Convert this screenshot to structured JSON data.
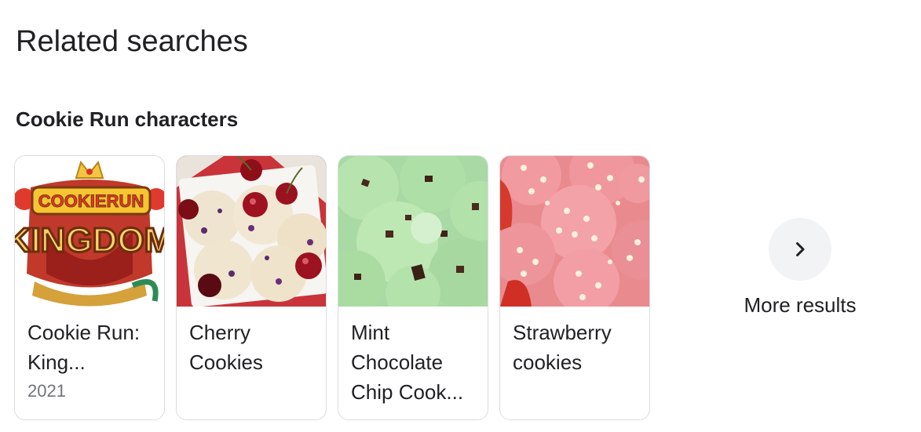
{
  "section_title": "Related searches",
  "group_title": "Cookie Run characters",
  "cards": [
    {
      "title": "Cookie Run:\nKing...",
      "subtitle": "2021",
      "image": "cookie-run-kingdom-logo"
    },
    {
      "title": "Cherry\nCookies",
      "subtitle": "",
      "image": "cherry-cookies-photo"
    },
    {
      "title": "Mint\nChocolate\nChip Cook...",
      "subtitle": "",
      "image": "mint-chocolate-chip-cookies-photo"
    },
    {
      "title": "Strawberry\ncookies",
      "subtitle": "",
      "image": "strawberry-cookies-photo"
    }
  ],
  "more": {
    "label": "More results",
    "icon": "chevron-right-icon"
  },
  "logo_text": {
    "top": "COOKIERUN",
    "bottom": "KINGDOM"
  },
  "colors": {
    "text": "#202124",
    "secondary": "#70757a",
    "border": "#dadce0",
    "button_bg": "#f1f3f4"
  }
}
